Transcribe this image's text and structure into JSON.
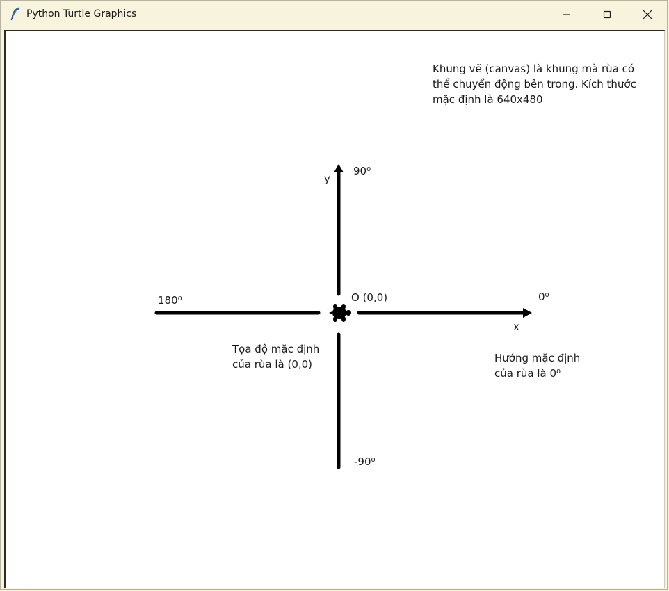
{
  "window": {
    "title": "Python Turtle Graphics"
  },
  "controls": {
    "minimize_icon": "minimize-icon",
    "maximize_icon": "maximize-icon",
    "close_icon": "close-icon"
  },
  "canvas": {
    "info_line1": "Khung vẽ (canvas) là khung mà rùa có",
    "info_line2": "thể chuyển động bên trong. Kích thước",
    "info_line3": "mặc định là 640x480",
    "label_90": "90⁰",
    "label_y": "y",
    "label_origin": "O (0,0)",
    "label_180": "180⁰",
    "label_0": "0⁰",
    "label_x": "x",
    "label_neg90": "-90⁰",
    "note_position_line1": "Tọa độ mặc định",
    "note_position_line2": "của rùa là (0,0)",
    "note_heading_line1": "Hướng mặc định",
    "note_heading_line2": "của rùa là 0⁰"
  },
  "colors": {
    "titlebar": "#f8f3dc",
    "canvas_bg": "#ffffff",
    "ink": "#000000"
  }
}
